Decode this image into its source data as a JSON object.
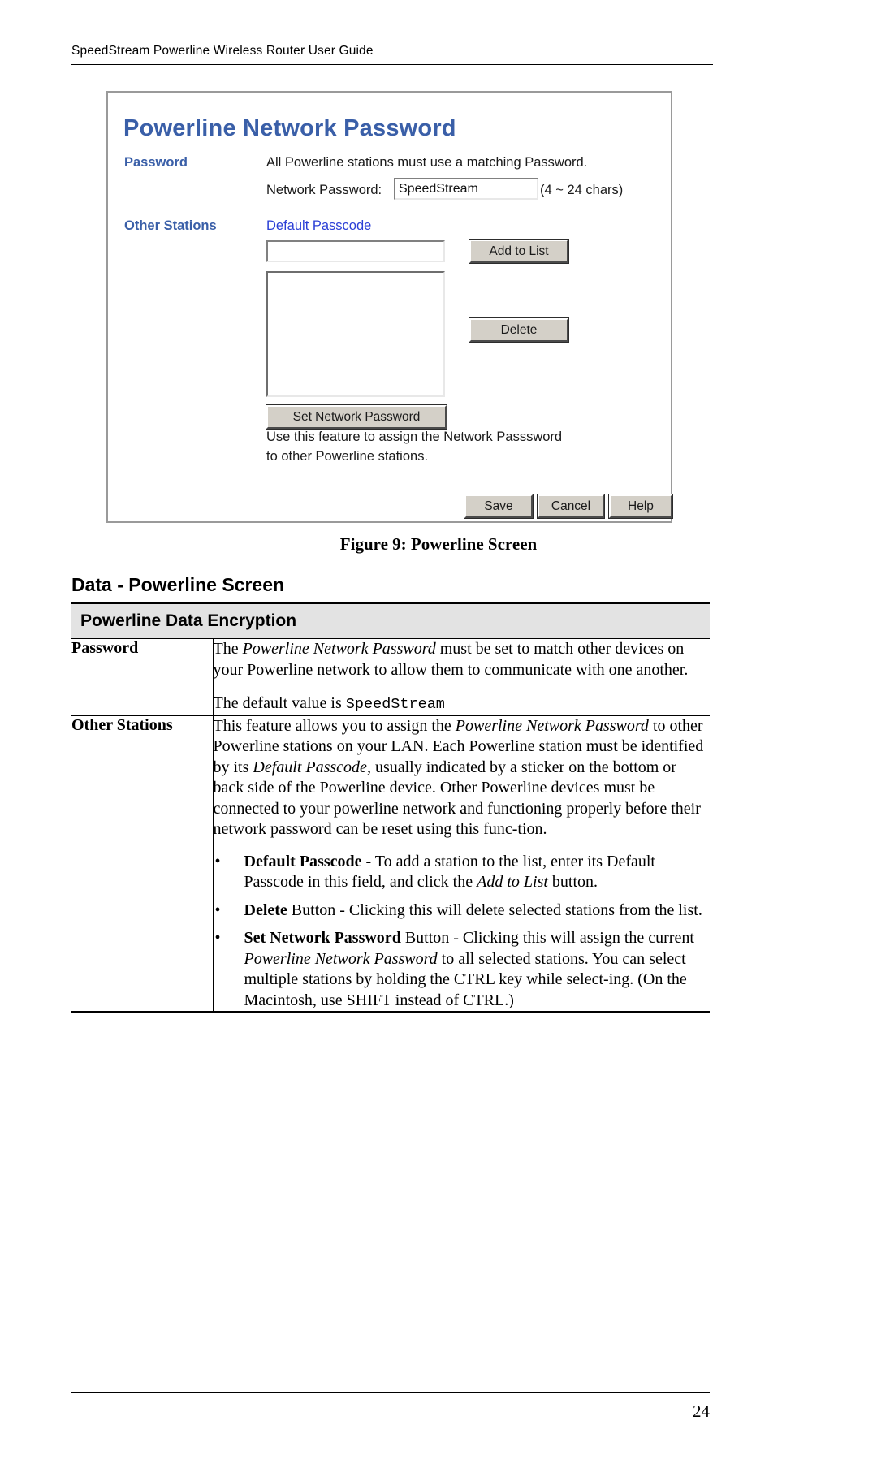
{
  "document": {
    "running_header": "SpeedStream Powerline Wireless Router User Guide",
    "page_number": "24"
  },
  "figure": {
    "caption": "Figure 9: Powerline Screen",
    "screen": {
      "title": "Powerline Network Password",
      "password_section_label": "Password",
      "other_stations_section_label": "Other Stations",
      "matching_note": "All Powerline stations must use a matching Password.",
      "network_password_label": "Network Password:",
      "network_password_value": "SpeedStream",
      "network_password_hint": "(4 ~ 24 chars)",
      "default_passcode_link": "Default Passcode",
      "passcode_input_value": "",
      "stations_list_items": [],
      "add_to_list_button": "Add to List",
      "delete_button": "Delete",
      "set_network_password_button": "Set Network Password",
      "help_line_1": "Use this feature to assign the Network Passsword",
      "help_line_2": "to other Powerline stations.",
      "save_button": "Save",
      "cancel_button": "Cancel",
      "help_button": "Help",
      "title_color": "#3a5fa8",
      "link_color": "#2b3fd6",
      "button_face_color": "#d4d0c8"
    }
  },
  "section": {
    "heading": "Data - Powerline Screen"
  },
  "table": {
    "header": "Powerline Data Encryption",
    "rows": [
      {
        "label": "Password",
        "paragraphs": [
          {
            "parts": [
              {
                "text": "The ",
                "style": "normal"
              },
              {
                "text": "Powerline Network Password",
                "style": "italic"
              },
              {
                "text": " must be set to match other devices on your Powerline network to allow them to communicate with one another.",
                "style": "normal"
              }
            ]
          },
          {
            "parts": [
              {
                "text": "The default value is ",
                "style": "normal"
              },
              {
                "text": "SpeedStream",
                "style": "mono"
              }
            ]
          }
        ],
        "bullets": []
      },
      {
        "label": "Other Stations",
        "paragraphs": [
          {
            "parts": [
              {
                "text": "This feature allows you to assign the ",
                "style": "normal"
              },
              {
                "text": "Powerline Network Password",
                "style": "italic"
              },
              {
                "text": " to other Powerline stations on your LAN. Each Powerline station must be identified by its ",
                "style": "normal"
              },
              {
                "text": "Default Passcode",
                "style": "italic"
              },
              {
                "text": ", usually indicated by a sticker on the bottom or back side of the Powerline device. Other Powerline devices must be connected to your powerline network and functioning properly before their network password can be reset using this func-tion.",
                "style": "normal"
              }
            ]
          }
        ],
        "bullets": [
          {
            "parts": [
              {
                "text": "Default Passcode",
                "style": "bold"
              },
              {
                "text": " - To add a station to the list, enter its Default Passcode in this field, and click the ",
                "style": "normal"
              },
              {
                "text": "Add to List",
                "style": "italic"
              },
              {
                "text": " button.",
                "style": "normal"
              }
            ]
          },
          {
            "parts": [
              {
                "text": "Delete",
                "style": "bold"
              },
              {
                "text": " Button - Clicking this will delete selected stations from the list.",
                "style": "normal"
              }
            ]
          },
          {
            "parts": [
              {
                "text": "Set Network Password",
                "style": "bold"
              },
              {
                "text": " Button - Clicking this will assign the current ",
                "style": "normal"
              },
              {
                "text": "Powerline Network Password",
                "style": "italic"
              },
              {
                "text": " to all selected stations. You can select multiple stations by holding the CTRL key while select-ing. (On the Macintosh, use SHIFT instead of CTRL.)",
                "style": "normal"
              }
            ]
          }
        ]
      }
    ]
  }
}
